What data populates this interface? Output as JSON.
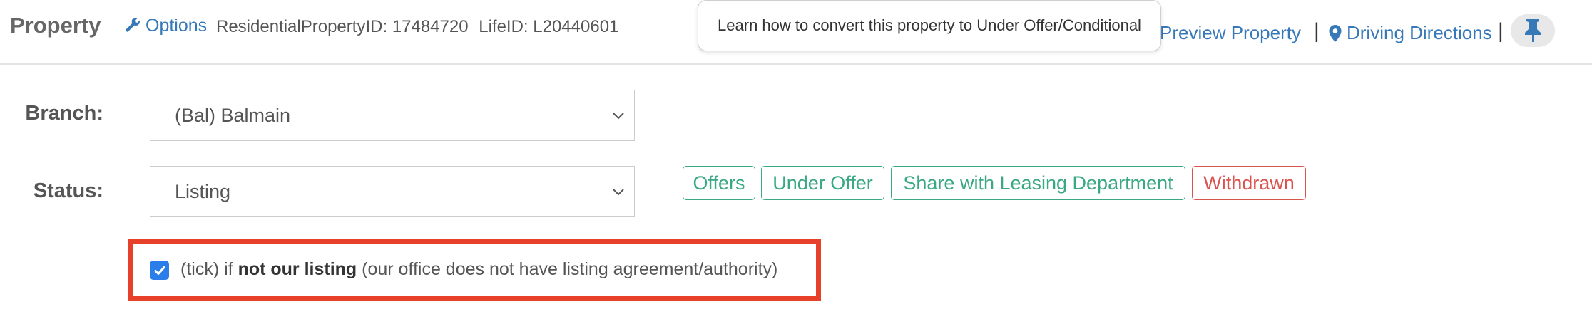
{
  "header": {
    "title": "Property",
    "options_label": "Options",
    "property_type": "Residential",
    "property_id": "PropertyID: 17484720",
    "life_id": "LifeID: L20440601",
    "tooltip_text": "Learn how to convert this property to Under Offer/Conditional",
    "preview_label": "Preview Property",
    "directions_label": "Driving Directions",
    "separator": "|"
  },
  "form": {
    "branch_label": "Branch:",
    "branch_value": "(Bal) Balmain",
    "status_label": "Status:",
    "status_value": "Listing"
  },
  "status_actions": [
    {
      "label": "Offers",
      "style": "success"
    },
    {
      "label": "Under Offer",
      "style": "success"
    },
    {
      "label": "Share with Leasing Department",
      "style": "success"
    },
    {
      "label": "Withdrawn",
      "style": "danger"
    }
  ],
  "listing_checkbox": {
    "checked": true,
    "prefix": "(tick) if",
    "bold_text": "not our listing",
    "suffix": "(our office does not have listing agreement/authority)"
  },
  "colors": {
    "link": "#3779b8",
    "success": "#3aa884",
    "danger": "#d9534f",
    "highlight": "#e8412b",
    "checkbox": "#2b7de9"
  },
  "icons": {
    "options": "wrench-icon",
    "directions": "map-marker-icon",
    "pin": "thumbtack-icon",
    "select": "chevron-down-icon",
    "checkbox": "check-icon"
  }
}
